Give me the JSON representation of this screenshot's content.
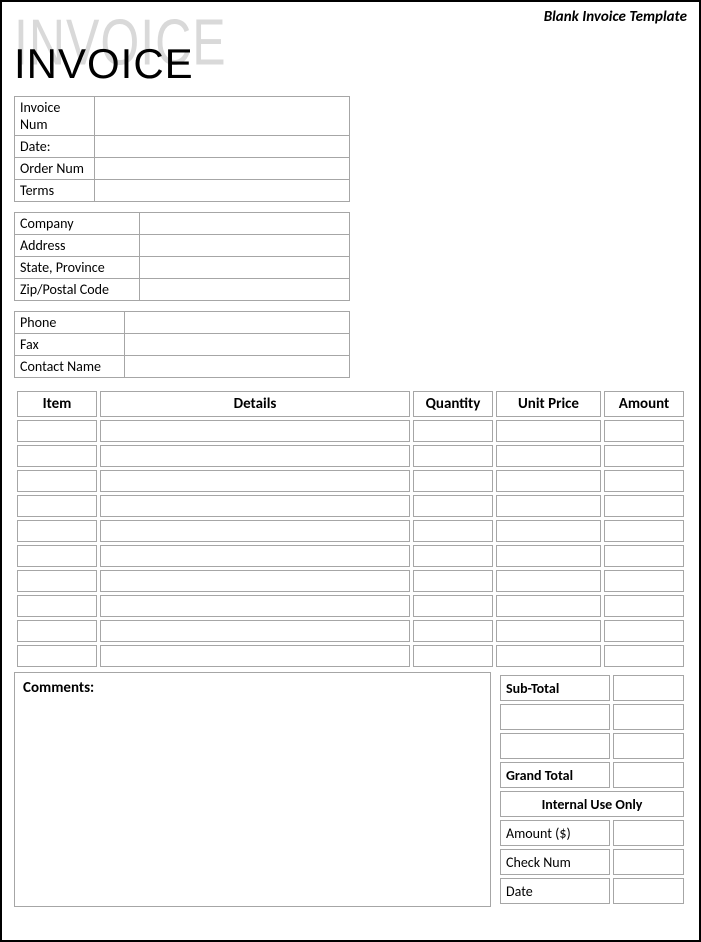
{
  "topLabel": "Blank Invoice Template",
  "logoText": "INVOICE",
  "meta": {
    "labels": [
      "Invoice Num",
      "Date:",
      "Order Num",
      "Terms"
    ],
    "values": [
      "",
      "",
      "",
      ""
    ]
  },
  "company": {
    "labels": [
      "Company",
      "Address",
      "State, Province",
      "Zip/Postal Code"
    ],
    "values": [
      "",
      "",
      "",
      ""
    ]
  },
  "contact": {
    "labels": [
      "Phone",
      "Fax",
      "Contact Name"
    ],
    "values": [
      "",
      "",
      ""
    ]
  },
  "itemsHeaders": [
    "Item",
    "Details",
    "Quantity",
    "Unit Price",
    "Amount"
  ],
  "itemsRows": [
    [
      "",
      "",
      "",
      "",
      ""
    ],
    [
      "",
      "",
      "",
      "",
      ""
    ],
    [
      "",
      "",
      "",
      "",
      ""
    ],
    [
      "",
      "",
      "",
      "",
      ""
    ],
    [
      "",
      "",
      "",
      "",
      ""
    ],
    [
      "",
      "",
      "",
      "",
      ""
    ],
    [
      "",
      "",
      "",
      "",
      ""
    ],
    [
      "",
      "",
      "",
      "",
      ""
    ],
    [
      "",
      "",
      "",
      "",
      ""
    ],
    [
      "",
      "",
      "",
      "",
      ""
    ]
  ],
  "commentsLabel": "Comments:",
  "totals": {
    "subTotalLabel": "Sub-Total",
    "subTotalValue": "",
    "blankRows": [
      [
        "",
        ""
      ],
      [
        "",
        ""
      ]
    ],
    "grandTotalLabel": "Grand Total",
    "grandTotalValue": "",
    "internalHeader": "Internal Use Only",
    "internalRows": [
      {
        "label": "Amount ($)",
        "value": ""
      },
      {
        "label": "Check Num",
        "value": ""
      },
      {
        "label": "Date",
        "value": ""
      }
    ]
  }
}
